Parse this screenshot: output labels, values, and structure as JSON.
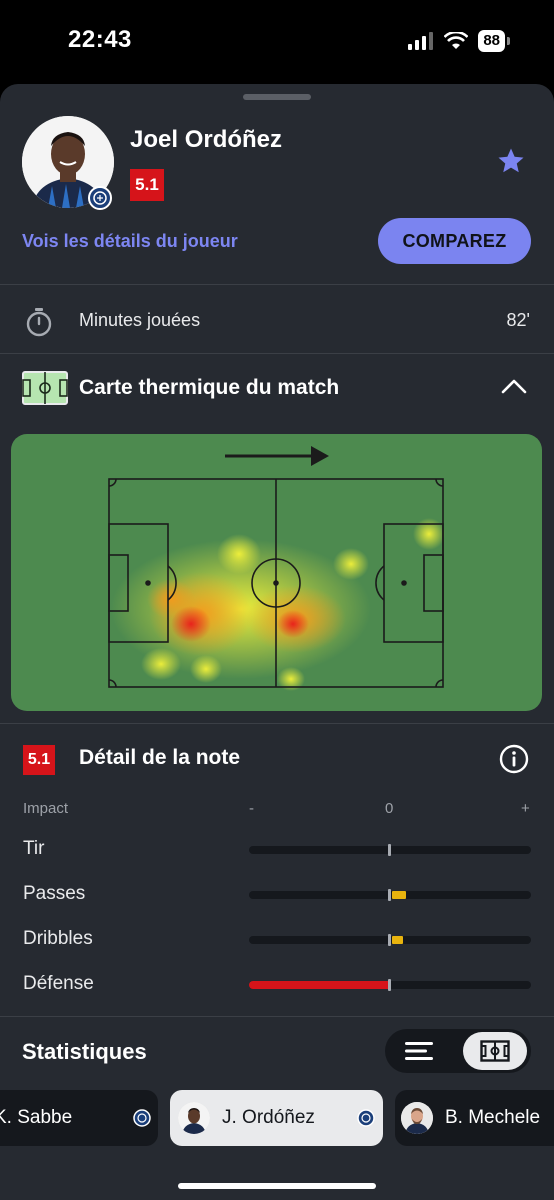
{
  "status_bar": {
    "time": "22:43",
    "battery": "88"
  },
  "player": {
    "name": "Joel Ordóñez",
    "rating": "5.1"
  },
  "actions": {
    "details_link": "Vois les détails du joueur",
    "compare_label": "COMPAREZ"
  },
  "minutes": {
    "label": "Minutes jouées",
    "value": "82'"
  },
  "heatmap": {
    "title": "Carte thermique du match"
  },
  "rating_detail": {
    "title": "Détail de la note",
    "rating": "5.1",
    "scale": {
      "label": "Impact",
      "minus": "-",
      "zero": "0",
      "plus": "+"
    },
    "metrics": [
      {
        "label": "Tir",
        "impact": 0.0
      },
      {
        "label": "Passes",
        "impact": 0.1
      },
      {
        "label": "Dribbles",
        "impact": 0.08
      },
      {
        "label": "Défense",
        "impact": -1.0
      }
    ]
  },
  "stats": {
    "title": "Statistiques"
  },
  "players_strip": [
    {
      "name": "K. Sabbe",
      "active": false
    },
    {
      "name": "J. Ordóñez",
      "active": true
    },
    {
      "name": "B. Mechele",
      "active": false
    }
  ],
  "colors": {
    "accent": "#7b84f0",
    "rating_red": "#d6141a",
    "positive": "#e9b40e",
    "pitch": "#4d8a4f"
  }
}
